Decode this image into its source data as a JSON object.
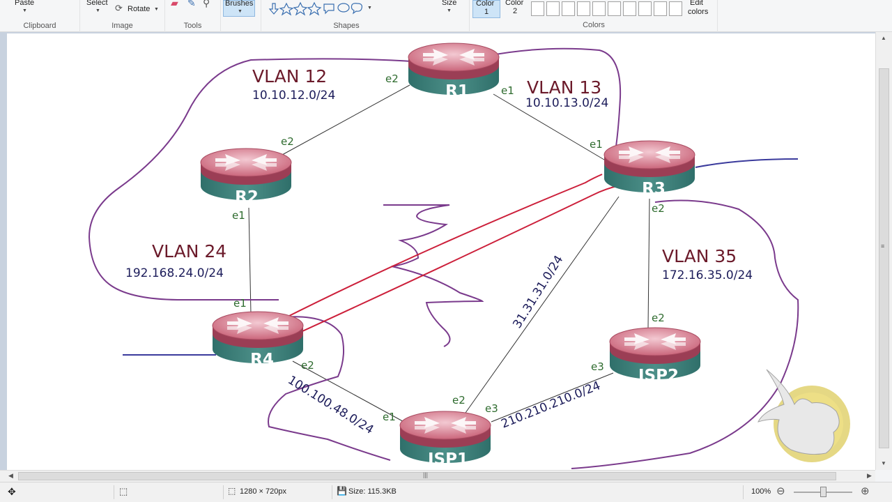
{
  "ribbon": {
    "paste": "Paste",
    "select": "Select",
    "rotate": "Rotate",
    "brushes": "Brushes",
    "size": "Size",
    "color1": "Color",
    "color1_num": "1",
    "color2": "Color",
    "color2_num": "2",
    "edit_colors_1": "Edit",
    "edit_colors_2": "colors",
    "groups": {
      "clipboard": "Clipboard",
      "image": "Image",
      "tools": "Tools",
      "shapes": "Shapes",
      "colors": "Colors"
    }
  },
  "diagram": {
    "routers": {
      "r1": "R1",
      "r2": "R2",
      "r3": "R3",
      "r4": "R4",
      "isp1": "ISP1",
      "isp2": "ISP2"
    },
    "vlans": {
      "vlan12": "VLAN 12",
      "vlan12_net": "10.10.12.0/24",
      "vlan13": "VLAN 13",
      "vlan13_net": "10.10.13.0/24",
      "vlan24": "VLAN 24",
      "vlan24_net": "192.168.24.0/24",
      "vlan35": "VLAN 35",
      "vlan35_net": "172.16.35.0/24"
    },
    "links": {
      "net_31": "31.31.31.0/24",
      "net_100": "100.100.48.0/24",
      "net_210": "210.210.210.0/24"
    },
    "interfaces": {
      "r1_e2": "e2",
      "r1_e1": "e1",
      "r2_e2": "e2",
      "r2_e1": "e1",
      "r3_e1": "e1",
      "r3_e2": "e2",
      "r4_e1": "e1",
      "r4_e2": "e2",
      "isp1_e1": "e1",
      "isp1_e2": "e2",
      "isp1_e3": "e3",
      "isp2_e2": "e2",
      "isp2_e3": "e3"
    },
    "colors": {
      "vlan_text": "#6b1a2a",
      "net_text": "#1c1c5a",
      "iface_text": "#2e6b2e",
      "annotation_purple": "#7a3a8c",
      "annotation_red": "#cc1f3a",
      "annotation_blue": "#3a3a9c"
    }
  },
  "status": {
    "dimensions": "1280 × 720px",
    "size": "Size: 115.3KB",
    "zoom": "100%"
  }
}
